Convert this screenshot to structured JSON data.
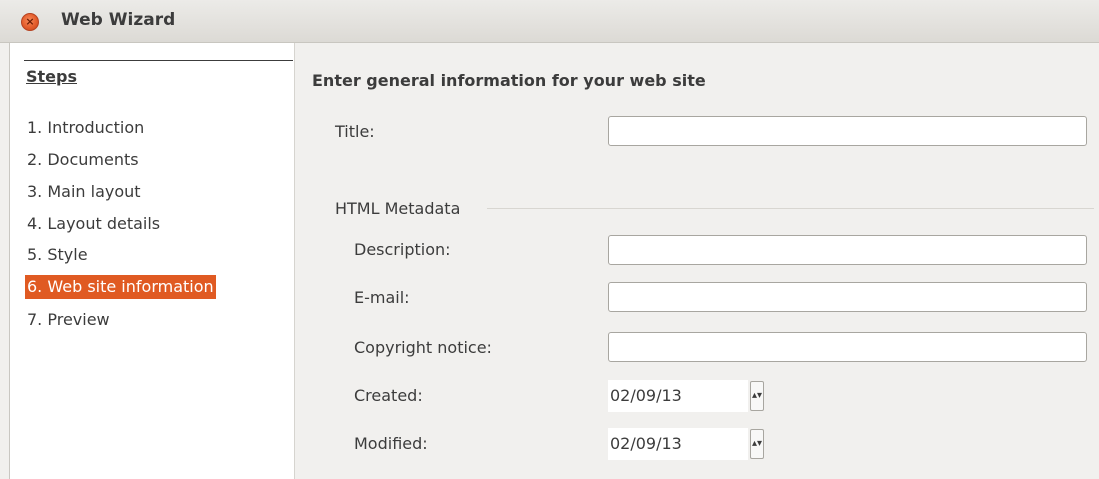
{
  "window": {
    "title": "Web Wizard",
    "close_icon": "close-icon",
    "close_glyph": "×"
  },
  "steps": {
    "heading": "Steps",
    "items": [
      {
        "label": "1. Introduction",
        "active": false
      },
      {
        "label": "2. Documents",
        "active": false
      },
      {
        "label": "3. Main layout",
        "active": false
      },
      {
        "label": "4. Layout details",
        "active": false
      },
      {
        "label": "5. Style",
        "active": false
      },
      {
        "label": "6. Web site information",
        "active": true
      },
      {
        "label": "7. Preview",
        "active": false
      }
    ],
    "active_color": "#e05a22"
  },
  "form": {
    "heading": "Enter general information for your web site",
    "title_label": "Title:",
    "title_value": "",
    "metadata_label": "HTML Metadata",
    "description_label": "Description:",
    "description_value": "",
    "email_label": "E-mail:",
    "email_value": "",
    "copyright_label": "Copyright notice:",
    "copyright_value": "",
    "created_label": "Created:",
    "created_value": "02/09/13",
    "modified_label": "Modified:",
    "modified_value": "02/09/13",
    "spin_icon": "spin-arrow-icon",
    "spin_glyph": "▴▾"
  }
}
